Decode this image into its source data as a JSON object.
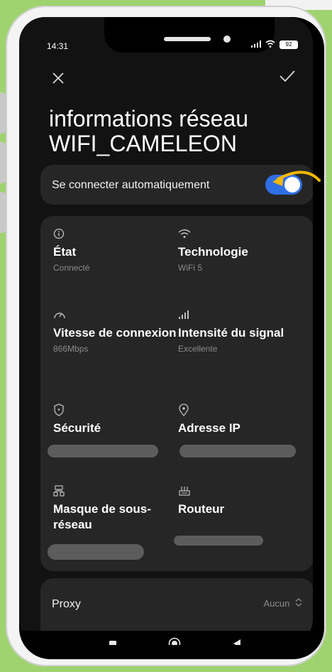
{
  "status_bar": {
    "time": "14:31",
    "battery": "92"
  },
  "header": {
    "title_line1": "informations réseau",
    "title_line2": "WIFI_CAMELEON"
  },
  "auto_connect": {
    "label": "Se connecter automatiquement",
    "enabled": true,
    "accent": "#2f6fe6"
  },
  "info": [
    {
      "icon": "info-icon",
      "label": "État",
      "value": "Connecté"
    },
    {
      "icon": "wifi-icon",
      "label": "Technologie",
      "value": "WiFi 5"
    },
    {
      "icon": "speed-icon",
      "label": "Vitesse de connexion",
      "value": "866Mbps"
    },
    {
      "icon": "signal-icon",
      "label": "Intensité du signal",
      "value": "Excellente"
    },
    {
      "icon": "shield-icon",
      "label": "Sécurité",
      "value": ""
    },
    {
      "icon": "location-icon",
      "label": "Adresse IP",
      "value": ""
    },
    {
      "icon": "network-icon",
      "label": "Masque de sous-réseau",
      "value": ""
    },
    {
      "icon": "router-icon",
      "label": "Routeur",
      "value": ""
    }
  ],
  "proxy": {
    "label": "Proxy",
    "value": "Aucun"
  },
  "colors": {
    "background": "#9fd36f",
    "screen": "#121212",
    "card": "#262626",
    "arrow": "#f5b800"
  }
}
